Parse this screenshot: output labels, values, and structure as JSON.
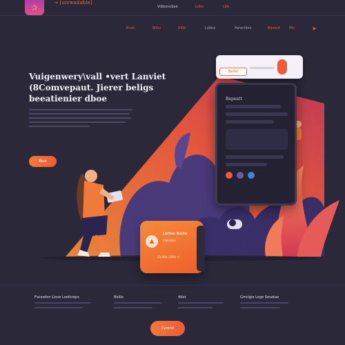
{
  "header": {
    "logo_glyph": "✰",
    "brand": "→ [unreadable]",
    "links": [
      "Vibbonoboe",
      "Lobu",
      "Lbb"
    ]
  },
  "nav": {
    "links": [
      "Brub",
      "Bilho",
      "Rifle",
      "Lobba",
      "Paranilloo",
      "Boneut",
      "Bfo"
    ],
    "icon": "rocket-icon"
  },
  "hero": {
    "title_lines": [
      "Vuigenwery\\vall •vert Lanviet",
      "(8Comvepaut. Jierer beligs",
      "beeatienier dboe"
    ],
    "cta": "Blub",
    "description_lines": 5
  },
  "phone": {
    "title": "Bapeatt",
    "search_tag": "Belfel"
  },
  "card": {
    "title": "Lbrtber Betllw",
    "subtitle": "Viibortiev",
    "footer": "10.000 (1000 •)"
  },
  "footer": {
    "columns": [
      {
        "heading": "Focesdon Liove Loeticwps"
      },
      {
        "heading": "Boilie"
      },
      {
        "heading": "Atlor"
      },
      {
        "heading": "Gmcigie Loge Sevatae"
      }
    ],
    "cta": "Cymnd"
  },
  "colors": {
    "background": "#2a2839",
    "accent": "#ef5a3c",
    "accent_orange": "#f27a3a",
    "purple": "#4b3a7a"
  }
}
